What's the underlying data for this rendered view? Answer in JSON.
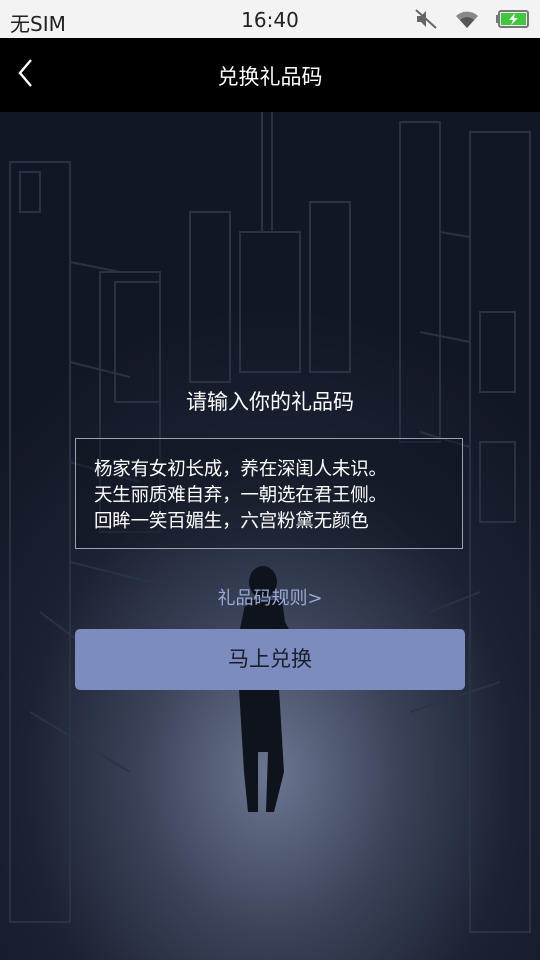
{
  "status_bar": {
    "carrier": "无SIM",
    "time": "16:40",
    "icons": [
      "mute-icon",
      "wifi-icon",
      "battery-charging-icon"
    ]
  },
  "nav": {
    "back_icon": "chevron-left-icon",
    "title": "兑换礼品码"
  },
  "main": {
    "prompt": "请输入你的礼品码",
    "code_input": {
      "value": "杨家有女初长成，养在深闺人未识。\n天生丽质难自弃，一朝选在君王侧。\n回眸一笑百媚生，六宫粉黛无颜色"
    },
    "rules_link": "礼品码规则>",
    "redeem_button": "马上兑换"
  },
  "colors": {
    "accent_button": "#7c8cbe",
    "link": "#9aa9d6",
    "nav_background": "#000000"
  }
}
